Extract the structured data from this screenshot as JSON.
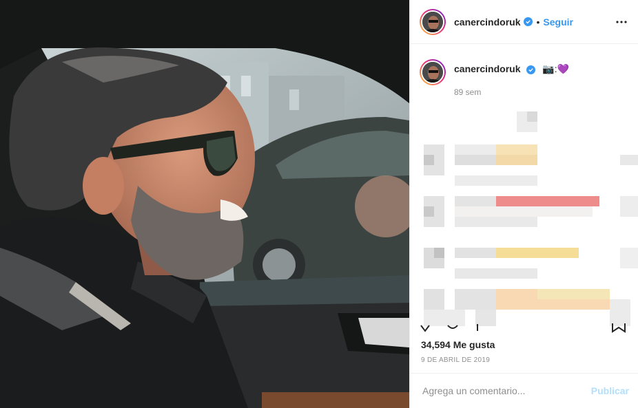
{
  "header": {
    "username": "canercindoruk",
    "separator": "•",
    "follow_label": "Seguir"
  },
  "caption": {
    "username": "canercindoruk",
    "text": "📷:💜",
    "age": "89 sem"
  },
  "post": {
    "likes": "34,594 Me gusta",
    "date": "9 DE ABRIL DE 2019"
  },
  "comment_box": {
    "placeholder": "Agrega un comentario...",
    "publish_label": "Publicar"
  },
  "colors": {
    "link_blue": "#3897f0",
    "publish_disabled": "#b2dffc",
    "muted_gray": "#8e8e8e",
    "caption_heart": "#a13de0"
  },
  "icons": [
    "verified-badge-icon",
    "more-options-icon",
    "heart-icon",
    "comment-icon",
    "share-icon",
    "save-bookmark-icon"
  ]
}
